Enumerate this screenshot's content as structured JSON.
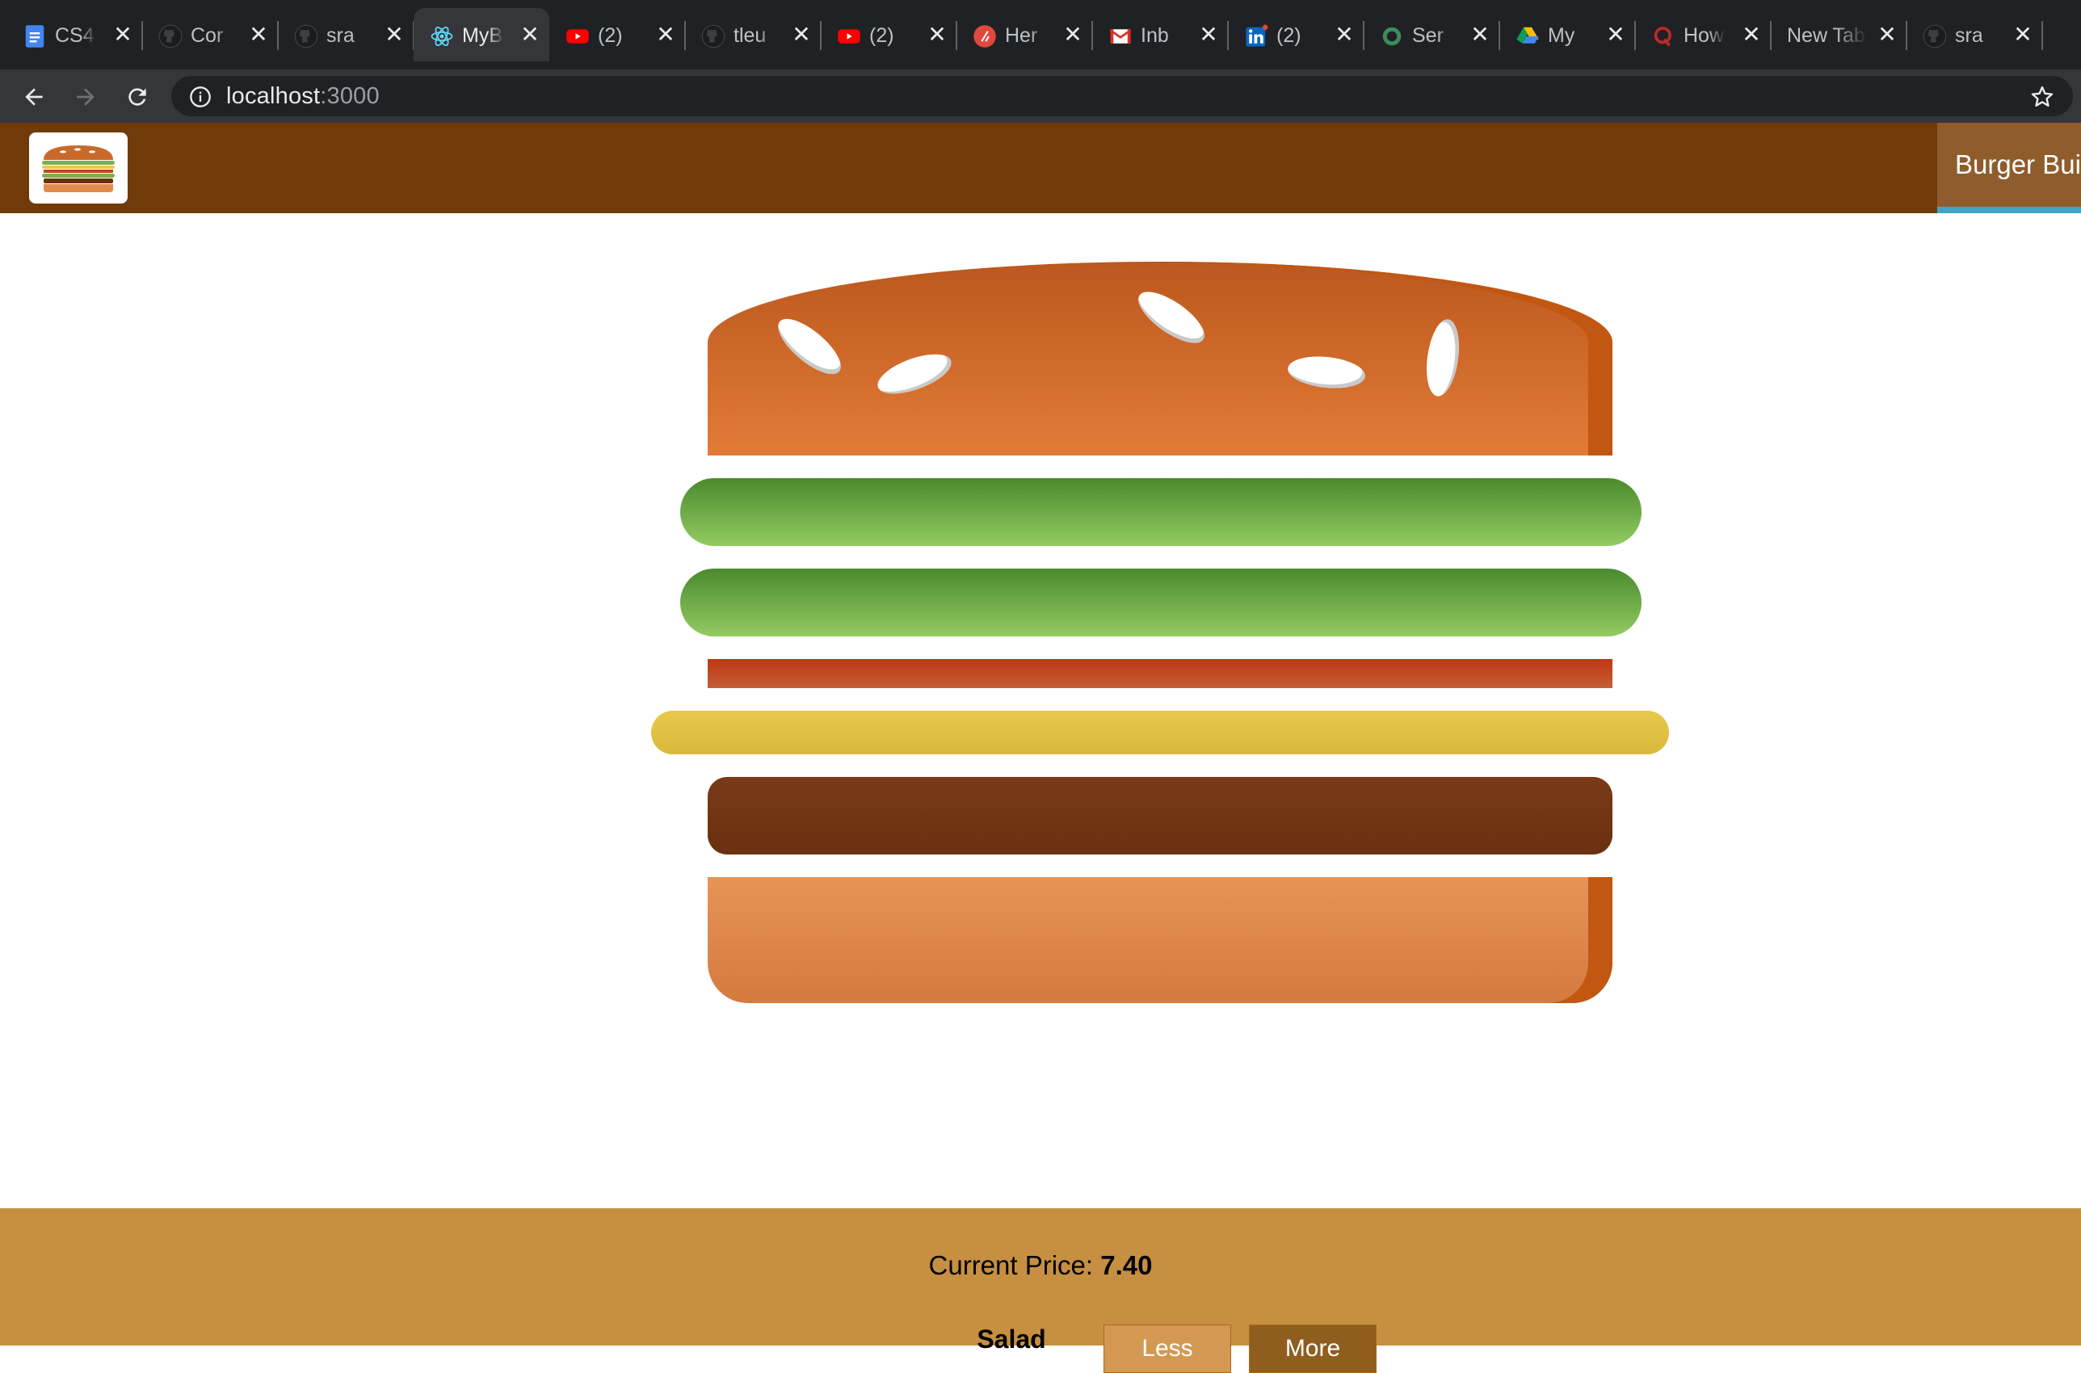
{
  "browser": {
    "tabs": [
      {
        "title": "CS4",
        "icon": "google-docs-icon",
        "color": "#4285f4"
      },
      {
        "title": "Cor",
        "icon": "github-icon",
        "color": "#1b1c1f"
      },
      {
        "title": "sra",
        "icon": "github-icon",
        "color": "#1b1c1f"
      },
      {
        "title": "MyB",
        "icon": "react-icon",
        "color": "#61dafb",
        "active": true
      },
      {
        "title": "(2)",
        "icon": "youtube-icon",
        "color": "#ff0000"
      },
      {
        "title": "tleu",
        "icon": "github-icon",
        "color": "#1b1c1f"
      },
      {
        "title": "(2)",
        "icon": "youtube-icon",
        "color": "#ff0000"
      },
      {
        "title": "Her",
        "icon": "heroku-icon",
        "color": "#e0493e"
      },
      {
        "title": "Inb",
        "icon": "gmail-icon",
        "color": "#d93025"
      },
      {
        "title": "(2)",
        "icon": "linkedin-icon",
        "color": "#0a66c2"
      },
      {
        "title": "Ser",
        "icon": "circle-icon",
        "color": "#3c8c5c"
      },
      {
        "title": "My",
        "icon": "google-drive-icon",
        "color": "#0f9d58"
      },
      {
        "title": "How",
        "icon": "quora-icon",
        "color": "#b92b27"
      },
      {
        "title": "New Tab",
        "icon": "none"
      },
      {
        "title": "sra",
        "icon": "github-icon",
        "color": "#1b1c1f"
      }
    ],
    "close_glyph": "✕",
    "url_host": "localhost",
    "url_port": ":3000"
  },
  "app": {
    "colors": {
      "header": "#703b09",
      "nav_active": "#8f5c2c",
      "nav_underline": "#40a4c8",
      "controls_bg": "#c68f41"
    },
    "nav": {
      "burger_builder": "Burger Builder"
    },
    "burger": {
      "layers": [
        "bread-top",
        "salad",
        "salad",
        "bacon",
        "cheese",
        "meat",
        "bread-bottom"
      ]
    },
    "controls": {
      "price_label": "Current Price: ",
      "price_value": "7.40",
      "row_label": "Salad",
      "less_label": "Less",
      "more_label": "More"
    }
  }
}
